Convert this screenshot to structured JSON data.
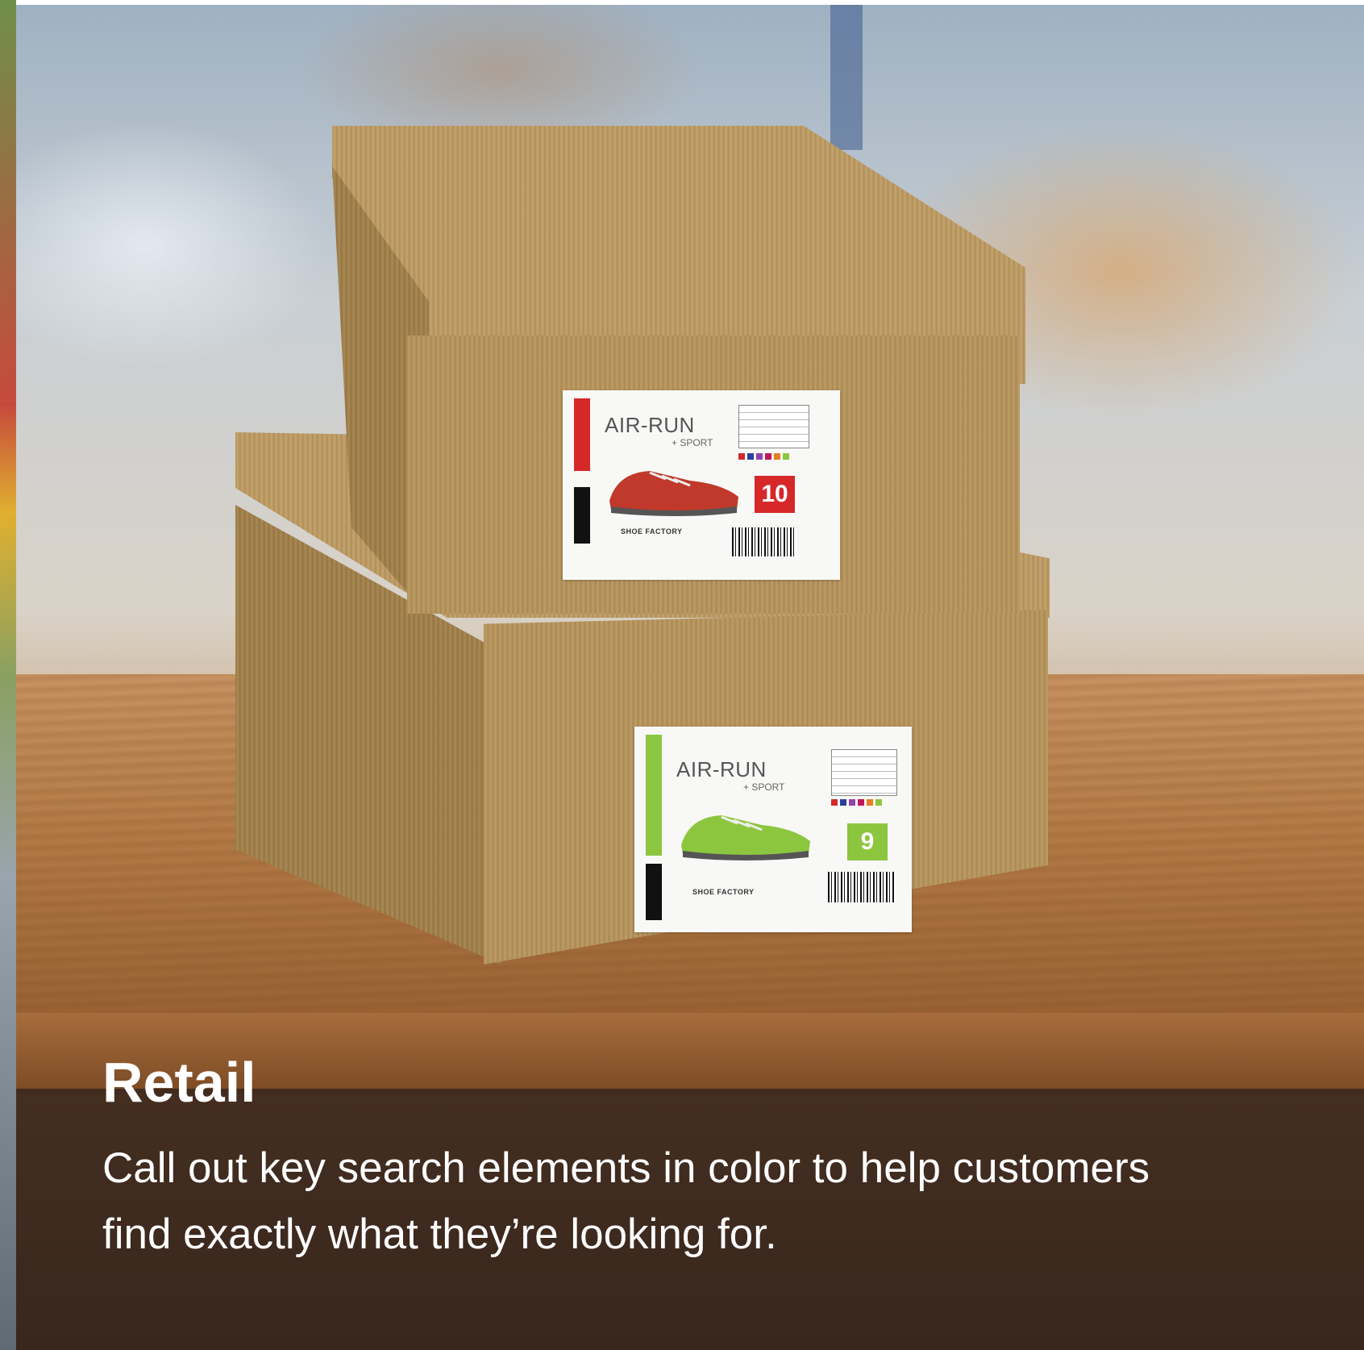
{
  "caption": {
    "title": "Retail",
    "description": "Call out key search elements in color to help customers find exactly what they’re looking for."
  },
  "labels": [
    {
      "brand": "AIR-RUN",
      "sub": "+ SPORT",
      "size": "10",
      "factory": "SHOE FACTORY",
      "accent_color": "#d62828"
    },
    {
      "brand": "AIR-RUN",
      "sub": "+ SPORT",
      "size": "9",
      "factory": "SHOE FACTORY",
      "accent_color": "#8cc63f"
    }
  ]
}
